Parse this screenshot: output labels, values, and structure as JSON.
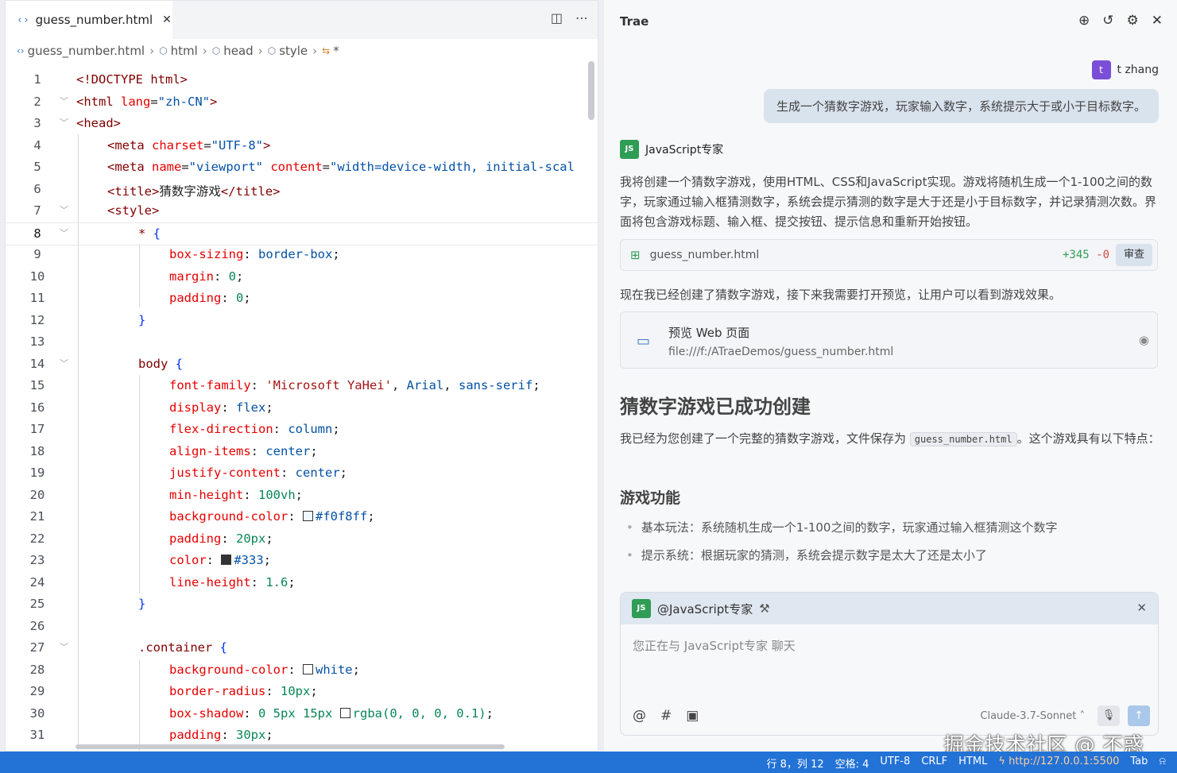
{
  "editor": {
    "tab_label": "guess_number.html",
    "breadcrumb": [
      "guess_number.html",
      "html",
      "head",
      "style",
      "*"
    ],
    "lines": [
      {
        "n": "1"
      },
      {
        "n": "2"
      },
      {
        "n": "3"
      },
      {
        "n": "4"
      },
      {
        "n": "5"
      },
      {
        "n": "6"
      },
      {
        "n": "7"
      },
      {
        "n": "8"
      },
      {
        "n": "9"
      },
      {
        "n": "10"
      },
      {
        "n": "11"
      },
      {
        "n": "12"
      },
      {
        "n": "13"
      },
      {
        "n": "14"
      },
      {
        "n": "15"
      },
      {
        "n": "16"
      },
      {
        "n": "17"
      },
      {
        "n": "18"
      },
      {
        "n": "19"
      },
      {
        "n": "20"
      },
      {
        "n": "21"
      },
      {
        "n": "22"
      },
      {
        "n": "23"
      },
      {
        "n": "24"
      },
      {
        "n": "25"
      },
      {
        "n": "26"
      },
      {
        "n": "27"
      },
      {
        "n": "28"
      },
      {
        "n": "29"
      },
      {
        "n": "30"
      },
      {
        "n": "31"
      }
    ],
    "code": {
      "l1": "<!DOCTYPE html>",
      "l2_a": "<html ",
      "l2_b": "lang",
      "l2_c": "=",
      "l2_d": "\"zh-CN\"",
      "l2_e": ">",
      "l3": "<head>",
      "l4_a": "<meta ",
      "l4_b": "charset",
      "l4_c": "=",
      "l4_d": "\"UTF-8\"",
      "l4_e": ">",
      "l5_a": "<meta ",
      "l5_b": "name",
      "l5_c": "=",
      "l5_d": "\"viewport\"",
      "l5_e": " content",
      "l5_f": "=",
      "l5_g": "\"width=device-width, initial-scal",
      "l6_a": "<title>",
      "l6_b": "猜数字游戏",
      "l6_c": "</title>",
      "l7": "<style>",
      "l8_a": "* ",
      "l8_b": "{",
      "l9_a": "box-sizing",
      ": ": ": ",
      "l9_b": "border-box",
      "l10_a": "margin",
      "l10_b": "0",
      "l11_a": "padding",
      "l11_b": "0",
      "l12": "}",
      "l14_a": "body ",
      "l14_b": "{",
      "l15_a": "font-family",
      "l15_b": "'Microsoft YaHei'",
      "l15_c": ", ",
      "l15_d": "Arial",
      "l15_e": ", ",
      "l15_f": "sans-serif",
      "l16_a": "display",
      "l16_b": "flex",
      "l17_a": "flex-direction",
      "l17_b": "column",
      "l18_a": "align-items",
      "l18_b": "center",
      "l19_a": "justify-content",
      "l19_b": "center",
      "l20_a": "min-height",
      "l20_b": "100vh",
      "l21_a": "background-color",
      "l21_b": "#f0f8ff",
      "l22_a": "padding",
      "l22_b": "20px",
      "l23_a": "color",
      "l23_b": "#333",
      "l24_a": "line-height",
      "l24_b": "1.6",
      "l25": "}",
      "l27_a": ".container ",
      "l27_b": "{",
      "l28_a": "background-color",
      "l28_b": "white",
      "l29_a": "border-radius",
      "l29_b": "10px",
      "l30_a": "box-shadow",
      "l30_b": "0 5px 15px ",
      "l30_c": "rgba(0, 0, 0, 0.1)",
      "l31_a": "padding",
      "l31_b": "30px"
    }
  },
  "panel": {
    "title": "Trae",
    "user_name": "t zhang",
    "user_initial": "t",
    "user_message": "生成一个猜数字游戏，玩家输入数字，系统提示大于或小于目标数字。",
    "agent_name": "JavaScript专家",
    "agent_logo": "JS",
    "intro": "我将创建一个猜数字游戏，使用HTML、CSS和JavaScript实现。游戏将随机生成一个1-100之间的数字，玩家通过输入框猜测数字，系统会提示猜测的数字是大于还是小于目标数字，并记录猜测次数。界面将包含游戏标题、输入框、提交按钮、提示信息和重新开始按钮。",
    "file_card": {
      "name": "guess_number.html",
      "added": "+345",
      "removed": "-0",
      "review_label": "审查"
    },
    "after_file": "现在我已经创建了猜数字游戏，接下来我需要打开预览，让用户可以看到游戏效果。",
    "preview": {
      "title": "预览 Web 页面",
      "url": "file:///f:/ATraeDemos/guess_number.html"
    },
    "heading": "猜数字游戏已成功创建",
    "summary_a": "我已经为您创建了一个完整的猜数字游戏，文件保存为 ",
    "summary_code": "guess_number.html",
    "summary_b": "。这个游戏具有以下特点：",
    "subheading": "游戏功能",
    "bullets": [
      "基本玩法：系统随机生成一个1-100之间的数字，玩家通过输入框猜测这个数字",
      "提示系统：根据玩家的猜测，系统会提示数字是太大了还是太小了"
    ],
    "chat": {
      "mention": "@JavaScript专家",
      "placeholder": "您正在与 JavaScript专家 聊天",
      "model": "Claude-3.7-Sonnet"
    }
  },
  "status": {
    "position": "行 8，列 12",
    "spaces": "空格: 4",
    "encoding": "UTF-8",
    "eol": "CRLF",
    "lang": "HTML",
    "server": "http://127.0.0.1:5500",
    "tab": "Tab"
  },
  "watermark": "掘金技术社区 @ 不惑_",
  "colors": {
    "accent": "#2372d6",
    "agent_green": "#2f9d55",
    "user_avatar": "#7a4ed6"
  }
}
